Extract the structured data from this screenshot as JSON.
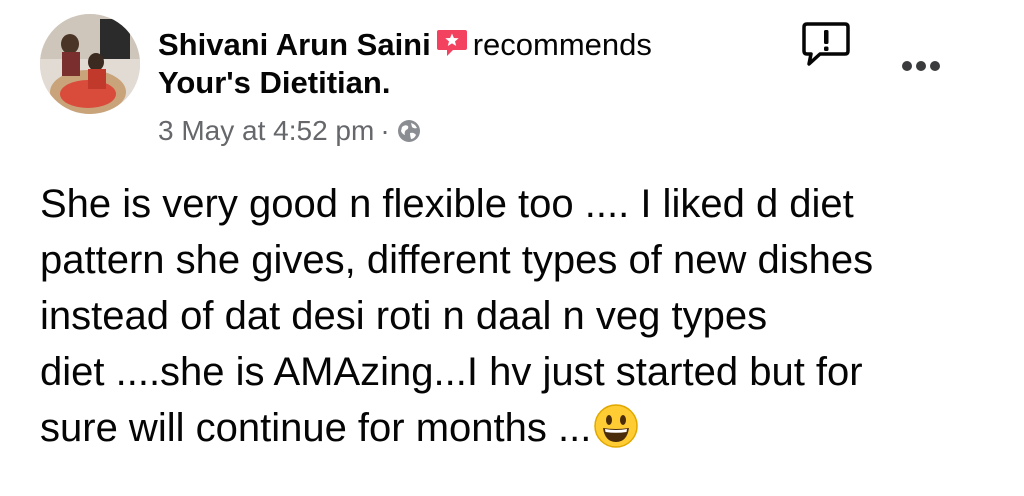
{
  "post": {
    "author_name": "Shivani Arun Saini",
    "recommend_icon": "recommend-badge-icon",
    "action_text": "recommends",
    "page_name": "Your's Dietitian.",
    "timestamp": "3 May at 4:52 pm",
    "separator": "·",
    "privacy_icon": "globe-icon",
    "body_lines": [
      "She is very good n flexible too .... I liked d diet",
      "pattern she gives, different types of new dishes",
      "instead of dat desi roti n daal n veg types",
      "diet ....she is AMAzing...I hv just started but for",
      "sure will continue for months ..."
    ],
    "emoji_icon": "grinning-face-emoji"
  },
  "header_actions": {
    "report_icon": "report-icon",
    "more_icon": "more-options-icon"
  },
  "colors": {
    "recommend_badge": "#f3425f",
    "meta_text": "#65676b",
    "body_text": "#050505"
  }
}
